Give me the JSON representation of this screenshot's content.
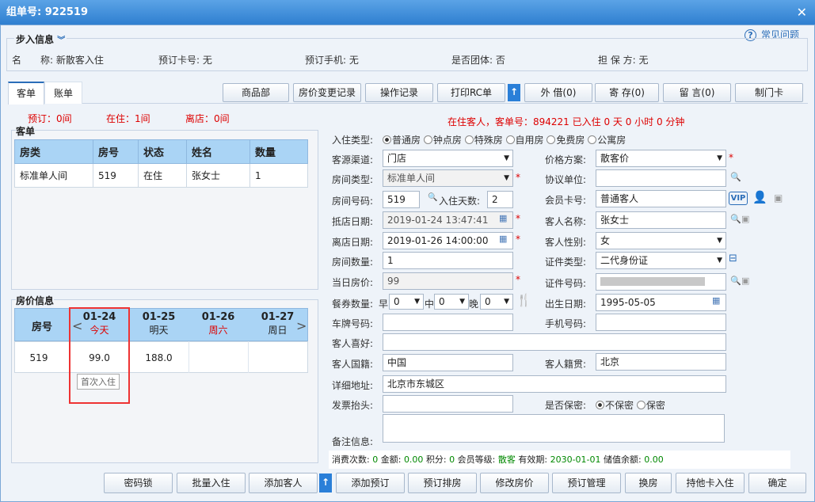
{
  "window": {
    "title": "组单号: 922519",
    "close": "✕"
  },
  "help": {
    "icon": "?",
    "label": "常见问题"
  },
  "step": {
    "title": "步入信息",
    "fields": [
      {
        "label": "名　　称:",
        "value": "新散客入住"
      },
      {
        "label": "预订卡号:",
        "value": "无"
      },
      {
        "label": "预订手机:",
        "value": "无"
      },
      {
        "label": "是否团体:",
        "value": "否"
      },
      {
        "label": "担 保 方:",
        "value": "无"
      }
    ]
  },
  "tabs": [
    "客单",
    "账单"
  ],
  "toolbar": [
    "商品部",
    "房价变更记录",
    "操作记录",
    "打印RC单",
    "外 借(0)",
    "寄 存(0)",
    "留 言(0)",
    "制门卡"
  ],
  "counts": {
    "reserved": "预订：0间",
    "staying": "在住：1间",
    "left": "离店：0间"
  },
  "staying_info": "在住客人，客单号：894221 已入住 0 天 0 小时 0 分钟",
  "guest_panel": {
    "title": "客单",
    "headers": [
      "房类",
      "房号",
      "状态",
      "姓名",
      "数量"
    ],
    "rows": [
      [
        "标准单人间",
        "519",
        "在住",
        "张女士",
        "1"
      ]
    ]
  },
  "price_panel": {
    "title": "房价信息",
    "room_header": "房号",
    "dates": [
      {
        "date": "01-24",
        "label": "今天",
        "red": true
      },
      {
        "date": "01-25",
        "label": "明天",
        "red": false
      },
      {
        "date": "01-26",
        "label": "周六",
        "red": true
      },
      {
        "date": "01-27",
        "label": "周日",
        "red": false
      }
    ],
    "rows": [
      {
        "room": "519",
        "prices": [
          "99.0",
          "188.0",
          "",
          ""
        ]
      }
    ],
    "tooltip": "首次入住"
  },
  "form": {
    "checkin_type_label": "入住类型:",
    "checkin_types": [
      {
        "t": "普通房",
        "on": true
      },
      {
        "t": "钟点房",
        "on": false
      },
      {
        "t": "特殊房",
        "on": false
      },
      {
        "t": "自用房",
        "on": false
      },
      {
        "t": "免费房",
        "on": false
      },
      {
        "t": "公寓房",
        "on": false
      }
    ],
    "source_label": "客源渠道:",
    "source": "门店",
    "price_plan_label": "价格方案:",
    "price_plan": "散客价",
    "room_type_label": "房间类型:",
    "room_type": "标准单人间",
    "agreement_label": "协议单位:",
    "agreement": "",
    "room_no_label": "房间号码:",
    "room_no": "519",
    "days_label": "入住天数:",
    "days": "2",
    "member_label": "会员卡号:",
    "member": "普通客人",
    "arrive_label": "抵店日期:",
    "arrive": "2019-01-24 13:47:41",
    "guest_name_label": "客人名称:",
    "guest_name": "张女士",
    "depart_label": "离店日期:",
    "depart": "2019-01-26 14:00:00",
    "gender_label": "客人性别:",
    "gender": "女",
    "room_count_label": "房间数量:",
    "room_count": "1",
    "id_type_label": "证件类型:",
    "id_type": "二代身份证",
    "day_price_label": "当日房价:",
    "day_price": "99",
    "id_no_label": "证件号码:",
    "meal_label": "餐券数量:",
    "breakfast": "早",
    "lunch": "中",
    "dinner": "晚",
    "meal_values": [
      "0",
      "0",
      "0"
    ],
    "birth_label": "出生日期:",
    "birth": "1995-05-05",
    "plate_label": "车牌号码:",
    "phone_label": "手机号码:",
    "pref_label": "客人喜好:",
    "nation_label": "客人国籍:",
    "nation": "中国",
    "native_label": "客人籍贯:",
    "native": "北京",
    "addr_label": "详细地址:",
    "addr": "北京市东城区",
    "invoice_label": "发票抬头:",
    "secret_label": "是否保密:",
    "secret_opts": [
      {
        "t": "不保密",
        "on": true
      },
      {
        "t": "保密",
        "on": false
      }
    ],
    "remark_label": "备注信息:",
    "vip": "VIP"
  },
  "stats": [
    {
      "label": "消费次数:",
      "value": "0"
    },
    {
      "label": "金额:",
      "value": "0.00"
    },
    {
      "label": "积分:",
      "value": "0"
    },
    {
      "label": "会员等级:",
      "value": "散客"
    },
    {
      "label": "有效期:",
      "value": "2030-01-01"
    },
    {
      "label": "储值余额:",
      "value": "0.00"
    }
  ],
  "bottom": [
    "密码锁",
    "批量入住",
    "添加客人",
    "添加预订",
    "预订排房",
    "修改房价",
    "预订管理",
    "换房",
    "持他卡入住",
    "确定"
  ]
}
